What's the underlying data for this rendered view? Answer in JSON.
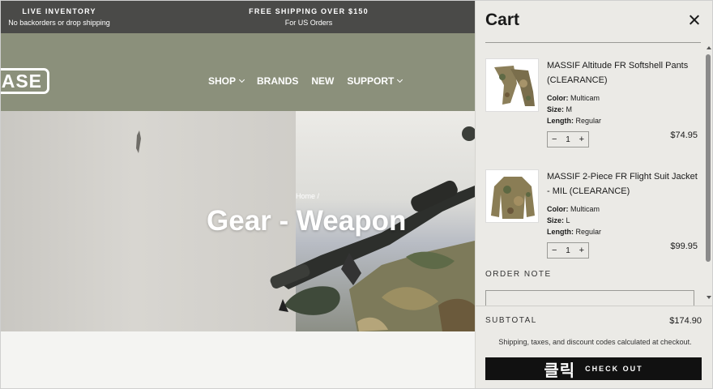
{
  "announcement": {
    "left_title": "LIVE INVENTORY",
    "left_sub": "No backorders or drop shipping",
    "center_title": "FREE SHIPPING OVER $150",
    "center_sub": "For US Orders"
  },
  "header": {
    "logo_text": "ASE",
    "menu": [
      {
        "label": "SHOP",
        "dropdown": true
      },
      {
        "label": "BRANDS",
        "dropdown": false
      },
      {
        "label": "NEW",
        "dropdown": false
      },
      {
        "label": "SUPPORT",
        "dropdown": true
      }
    ]
  },
  "hero": {
    "breadcrumb": "Home /",
    "title": "Gear - Weapon"
  },
  "cart": {
    "title": "Cart",
    "items": [
      {
        "name": "MASSIF Altitude FR Softshell Pants (CLEARANCE)",
        "color_label": "Color:",
        "color": "Multicam",
        "size_label": "Size:",
        "size": "M",
        "length_label": "Length:",
        "length": "Regular",
        "qty": "1",
        "price": "$74.95",
        "thumb_icon": "pants-thumbnail"
      },
      {
        "name": "MASSIF 2-Piece FR Flight Suit Jacket - MIL (CLEARANCE)",
        "color_label": "Color:",
        "color": "Multicam",
        "size_label": "Size:",
        "size": "L",
        "length_label": "Length:",
        "length": "Regular",
        "qty": "1",
        "price": "$99.95",
        "thumb_icon": "jacket-thumbnail"
      }
    ],
    "qty_minus": "−",
    "qty_plus": "+",
    "order_note_label": "ORDER NOTE",
    "subtotal_label": "SUBTOTAL",
    "subtotal_value": "$174.90",
    "shipping_note": "Shipping, taxes, and discount codes calculated at checkout.",
    "checkout_tag": "클릭",
    "checkout_label": "CHECK OUT"
  },
  "colors": {
    "topbar": "#4a4a48",
    "nav": "#8b907b",
    "drawer": "#ebeae6",
    "checkout": "#111111"
  }
}
